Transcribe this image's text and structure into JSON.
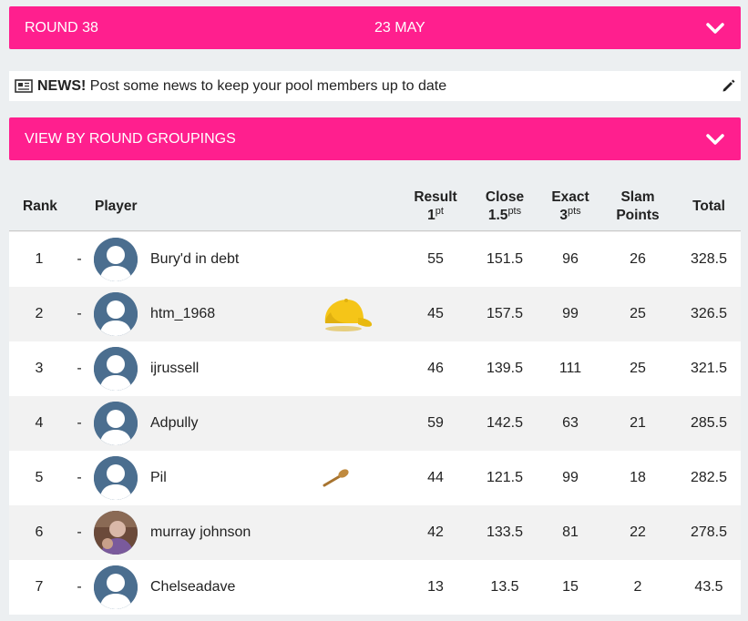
{
  "round_bar": {
    "round": "ROUND 38",
    "date": "23 MAY",
    "icon": "chevron-down-icon"
  },
  "news": {
    "label": "NEWS!",
    "text": "Post some news to keep your pool members up to date",
    "icon": "newspaper-icon",
    "edit_icon": "pencil-icon"
  },
  "grouping_bar": {
    "label": "VIEW BY ROUND GROUPINGS",
    "icon": "chevron-down-icon"
  },
  "table": {
    "headers": {
      "rank": "Rank",
      "player": "Player",
      "result": "Result",
      "result_pts": "1",
      "result_sup": "pt",
      "close": "Close",
      "close_pts": "1.5",
      "close_sup": "pts",
      "exact": "Exact",
      "exact_pts": "3",
      "exact_sup": "pts",
      "slam": "Slam",
      "slam2": "Points",
      "total": "Total"
    },
    "rows": [
      {
        "rank": "1",
        "movement": "-",
        "name": "Bury'd in debt",
        "avatar": "default",
        "badge": "",
        "result": "55",
        "close": "151.5",
        "exact": "96",
        "slam": "26",
        "total": "328.5"
      },
      {
        "rank": "2",
        "movement": "-",
        "name": "htm_1968",
        "avatar": "default",
        "badge": "yellow-cap-icon",
        "result": "45",
        "close": "157.5",
        "exact": "99",
        "slam": "25",
        "total": "326.5"
      },
      {
        "rank": "3",
        "movement": "-",
        "name": "ijrussell",
        "avatar": "default",
        "badge": "",
        "result": "46",
        "close": "139.5",
        "exact": "111",
        "slam": "25",
        "total": "321.5"
      },
      {
        "rank": "4",
        "movement": "-",
        "name": "Adpully",
        "avatar": "default",
        "badge": "",
        "result": "59",
        "close": "142.5",
        "exact": "63",
        "slam": "21",
        "total": "285.5"
      },
      {
        "rank": "5",
        "movement": "-",
        "name": "Pil",
        "avatar": "default",
        "badge": "wooden-spoon-icon",
        "result": "44",
        "close": "121.5",
        "exact": "99",
        "slam": "18",
        "total": "282.5"
      },
      {
        "rank": "6",
        "movement": "-",
        "name": "murray johnson",
        "avatar": "photo",
        "badge": "",
        "result": "42",
        "close": "133.5",
        "exact": "81",
        "slam": "22",
        "total": "278.5"
      },
      {
        "rank": "7",
        "movement": "-",
        "name": "Chelseadave",
        "avatar": "default",
        "badge": "",
        "result": "13",
        "close": "13.5",
        "exact": "15",
        "slam": "2",
        "total": "43.5"
      }
    ]
  },
  "colors": {
    "accent": "#ff1f8e",
    "background": "#eceff1",
    "avatar": "#4b6e8f",
    "cap": "#f5c518",
    "spoon": "#c08a3e"
  }
}
